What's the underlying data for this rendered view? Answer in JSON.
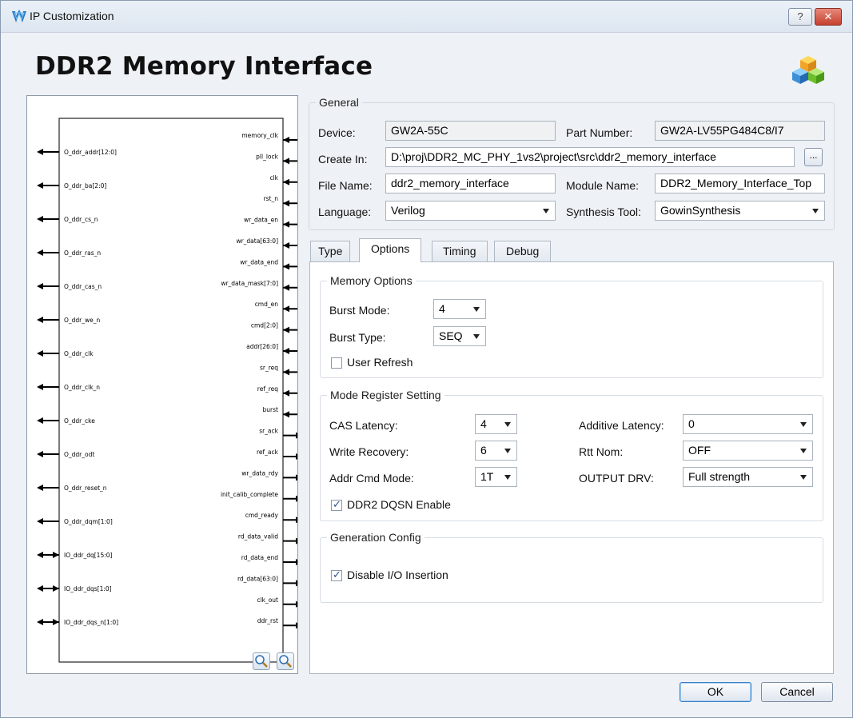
{
  "window": {
    "title": "IP Customization",
    "help_label": "?",
    "close_label": "✕"
  },
  "header": {
    "title": "DDR2 Memory Interface"
  },
  "symbol": {
    "left_ports": [
      {
        "name": "O_ddr_addr[12:0]",
        "dir": "out"
      },
      {
        "name": "O_ddr_ba[2:0]",
        "dir": "out"
      },
      {
        "name": "O_ddr_cs_n",
        "dir": "out"
      },
      {
        "name": "O_ddr_ras_n",
        "dir": "out"
      },
      {
        "name": "O_ddr_cas_n",
        "dir": "out"
      },
      {
        "name": "O_ddr_we_n",
        "dir": "out"
      },
      {
        "name": "O_ddr_clk",
        "dir": "out"
      },
      {
        "name": "O_ddr_clk_n",
        "dir": "out"
      },
      {
        "name": "O_ddr_cke",
        "dir": "out"
      },
      {
        "name": "O_ddr_odt",
        "dir": "out"
      },
      {
        "name": "O_ddr_reset_n",
        "dir": "out"
      },
      {
        "name": "O_ddr_dqm[1:0]",
        "dir": "out"
      },
      {
        "name": "IO_ddr_dq[15:0]",
        "dir": "inout"
      },
      {
        "name": "IO_ddr_dqs[1:0]",
        "dir": "inout"
      },
      {
        "name": "IO_ddr_dqs_n[1:0]",
        "dir": "inout"
      }
    ],
    "right_ports": [
      {
        "name": "memory_clk",
        "dir": "in"
      },
      {
        "name": "pll_lock",
        "dir": "in"
      },
      {
        "name": "clk",
        "dir": "in"
      },
      {
        "name": "rst_n",
        "dir": "in"
      },
      {
        "name": "wr_data_en",
        "dir": "in"
      },
      {
        "name": "wr_data[63:0]",
        "dir": "in"
      },
      {
        "name": "wr_data_end",
        "dir": "in"
      },
      {
        "name": "wr_data_mask[7:0]",
        "dir": "in"
      },
      {
        "name": "cmd_en",
        "dir": "in"
      },
      {
        "name": "cmd[2:0]",
        "dir": "in"
      },
      {
        "name": "addr[26:0]",
        "dir": "in"
      },
      {
        "name": "sr_req",
        "dir": "in"
      },
      {
        "name": "ref_req",
        "dir": "in"
      },
      {
        "name": "burst",
        "dir": "in"
      },
      {
        "name": "sr_ack",
        "dir": "out"
      },
      {
        "name": "ref_ack",
        "dir": "out"
      },
      {
        "name": "wr_data_rdy",
        "dir": "out"
      },
      {
        "name": "init_calib_complete",
        "dir": "out"
      },
      {
        "name": "cmd_ready",
        "dir": "out"
      },
      {
        "name": "rd_data_valid",
        "dir": "out"
      },
      {
        "name": "rd_data_end",
        "dir": "out"
      },
      {
        "name": "rd_data[63:0]",
        "dir": "out"
      },
      {
        "name": "clk_out",
        "dir": "out"
      },
      {
        "name": "ddr_rst",
        "dir": "out"
      }
    ]
  },
  "general": {
    "legend": "General",
    "device_label": "Device:",
    "device_value": "GW2A-55C",
    "part_number_label": "Part Number:",
    "part_number_value": "GW2A-LV55PG484C8/I7",
    "create_in_label": "Create In:",
    "create_in_value": "D:\\proj\\DDR2_MC_PHY_1vs2\\project\\src\\ddr2_memory_interface",
    "browse_label": "...",
    "file_name_label": "File Name:",
    "file_name_value": "ddr2_memory_interface",
    "module_name_label": "Module Name:",
    "module_name_value": "DDR2_Memory_Interface_Top",
    "language_label": "Language:",
    "language_value": "Verilog",
    "synthesis_tool_label": "Synthesis Tool:",
    "synthesis_tool_value": "GowinSynthesis"
  },
  "tabs": [
    "Type",
    "Options",
    "Timing",
    "Debug"
  ],
  "options": {
    "memory_options": {
      "legend": "Memory Options",
      "burst_mode_label": "Burst Mode:",
      "burst_mode_value": "4",
      "burst_type_label": "Burst Type:",
      "burst_type_value": "SEQ",
      "user_refresh_label": "User Refresh",
      "user_refresh_checked": false
    },
    "mode_register": {
      "legend": "Mode Register Setting",
      "cas_latency_label": "CAS Latency:",
      "cas_latency_value": "4",
      "write_recovery_label": "Write Recovery:",
      "write_recovery_value": "6",
      "addr_cmd_mode_label": "Addr Cmd Mode:",
      "addr_cmd_mode_value": "1T",
      "additive_latency_label": "Additive Latency:",
      "additive_latency_value": "0",
      "rtt_nom_label": "Rtt Nom:",
      "rtt_nom_value": "OFF",
      "output_drv_label": "OUTPUT DRV:",
      "output_drv_value": "Full strength",
      "dqsn_enable_label": "DDR2 DQSN Enable",
      "dqsn_enable_checked": true
    },
    "generation_config": {
      "legend": "Generation Config",
      "disable_io_label": "Disable I/O Insertion",
      "disable_io_checked": true
    }
  },
  "footer": {
    "ok_label": "OK",
    "cancel_label": "Cancel"
  }
}
